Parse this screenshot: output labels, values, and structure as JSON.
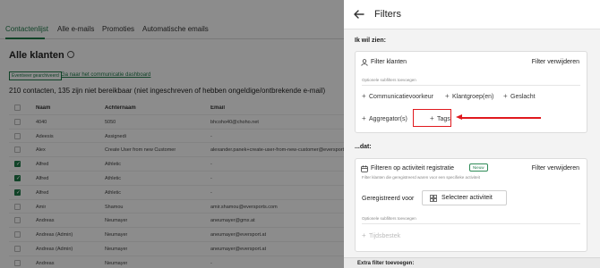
{
  "background": {
    "tabs": [
      "Contactenlijst",
      "Alle e-mails",
      "Promoties",
      "Automatische emails"
    ],
    "page_title": "Alle klanten",
    "button_label": "Eventveer gearchiveerd",
    "dashboard_link": "Ga naar het communicatie dashboard",
    "count_text": "210 contacten, 135 zijn niet bereikbaar (niet ingeschreven of hebben ongeldige/ontbrekende e-mail)",
    "table": {
      "headers": [
        "Naam",
        "Achternaam",
        "Email"
      ],
      "rows": [
        {
          "checked": false,
          "name": "4040",
          "last": "5050",
          "email": "bhcoho40@choho.net"
        },
        {
          "checked": false,
          "name": "Adeesis",
          "last": "Assignedi",
          "email": "-"
        },
        {
          "checked": false,
          "name": "Alex",
          "last": "Create User from new Customer",
          "email": "alexander.panek+create-user-from-new-customer@eversports.com"
        },
        {
          "checked": true,
          "name": "Alfred",
          "last": "Athletic",
          "email": "-"
        },
        {
          "checked": true,
          "name": "Alfred",
          "last": "Athletic",
          "email": "-"
        },
        {
          "checked": true,
          "name": "Alfred",
          "last": "Athletic",
          "email": "-"
        },
        {
          "checked": false,
          "name": "Amir",
          "last": "Shamou",
          "email": "amir.shamou@eversports.com"
        },
        {
          "checked": false,
          "name": "Andreas",
          "last": "Neumayer",
          "email": "aneumayer@gmx.at"
        },
        {
          "checked": false,
          "name": "Andreas (Admin)",
          "last": "Neumayer",
          "email": "aneumayer@eversport.at"
        },
        {
          "checked": false,
          "name": "Andreas (Admin)",
          "last": "Neumayer",
          "email": "aneumayer@eversport.at"
        },
        {
          "checked": false,
          "name": "Andreas",
          "last": "Neumayer",
          "email": "-"
        }
      ]
    }
  },
  "panel": {
    "title": "Filters",
    "section1_label": "Ik wil zien:",
    "card1": {
      "title": "Filter klanten",
      "remove": "Filter verwijderen",
      "sublabel": "Optionele subfilters toevoegen",
      "subfilters": [
        "Communicatievoorkeur",
        "Klantgroep(en)",
        "Geslacht",
        "Aggregator(s)",
        "Tags"
      ]
    },
    "section2_label": "...dat:",
    "card2": {
      "title": "Filteren op activiteit registratie",
      "badge": "Nieuw",
      "remove": "Filter verwijderen",
      "description": "Filter klanten die geregistreerd waren voor een specifieke activiteit",
      "registered_label": "Geregistreerd voor",
      "select_label": "Selecteer activiteit",
      "sublabel": "Optionele subfilters toevoegen",
      "subfilters": [
        "Tijdsbestek"
      ]
    },
    "extra_filter": "Extra filter toevoegen:"
  },
  "colors": {
    "accent": "#1f7a4a",
    "annotation": "#e0191e"
  },
  "icons": {
    "back": "arrow-left-icon",
    "person": "person-icon",
    "calendar": "calendar-icon",
    "grid": "grid-icon"
  }
}
